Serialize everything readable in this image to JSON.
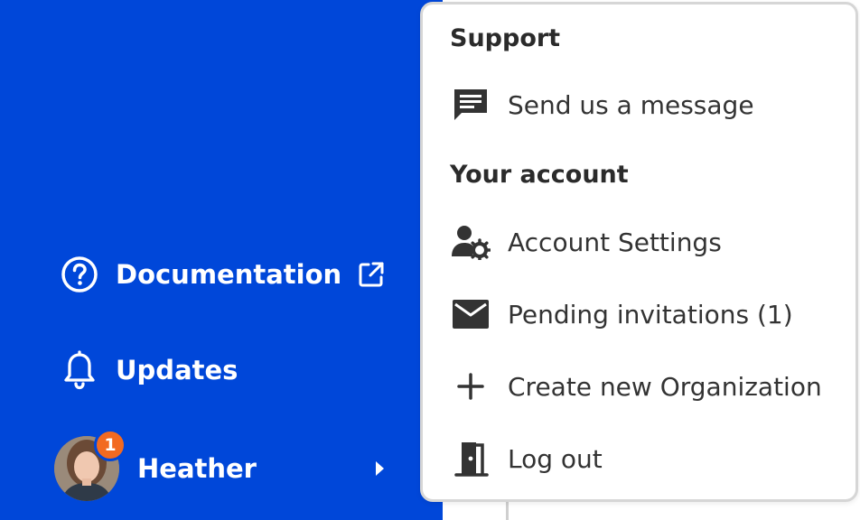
{
  "colors": {
    "sidebar_bg": "#0047d9",
    "badge": "#f26a21",
    "menu_text": "#333333"
  },
  "sidebar": {
    "documentation": {
      "label": "Documentation",
      "icon": "help-circle-icon",
      "trailing_icon": "external-link-icon"
    },
    "updates": {
      "label": "Updates",
      "icon": "bell-icon"
    },
    "user": {
      "name": "Heather",
      "notification_count": "1",
      "icon": "chevron-right-icon"
    }
  },
  "menu": {
    "support": {
      "title": "Support",
      "items": [
        {
          "label": "Send us a message",
          "icon": "message-icon"
        }
      ]
    },
    "account": {
      "title": "Your account",
      "items": [
        {
          "label": "Account Settings",
          "icon": "user-settings-icon"
        },
        {
          "label": "Pending invitations (1)",
          "icon": "envelope-icon"
        },
        {
          "label": "Create new Organization",
          "icon": "plus-icon"
        },
        {
          "label": "Log out",
          "icon": "door-exit-icon"
        }
      ]
    }
  }
}
